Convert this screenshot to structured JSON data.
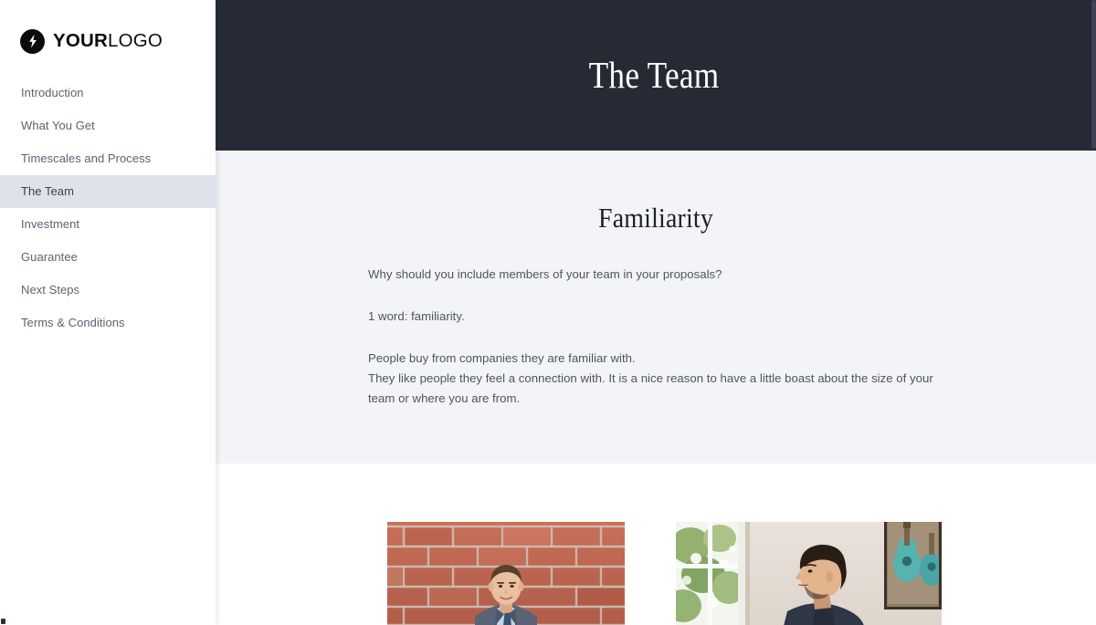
{
  "sidebar": {
    "logo": {
      "icon": "lightning-bolt-icon",
      "text_strong": "YOUR",
      "text_light": "LOGO"
    },
    "items": [
      {
        "label": "Introduction",
        "active": false
      },
      {
        "label": "What You Get",
        "active": false
      },
      {
        "label": "Timescales and Process",
        "active": false
      },
      {
        "label": "The Team",
        "active": true
      },
      {
        "label": "Investment",
        "active": false
      },
      {
        "label": "Guarantee",
        "active": false
      },
      {
        "label": "Next Steps",
        "active": false
      },
      {
        "label": "Terms & Conditions",
        "active": false
      }
    ]
  },
  "header": {
    "title": "The Team",
    "background_color": "#262a35",
    "text_color": "#ffffff"
  },
  "main": {
    "section": {
      "heading": "Familiarity",
      "background_color": "#f3f4f8",
      "paragraphs": [
        "Why should you include members of your team in your proposals?",
        "1 word: familiarity.",
        "People buy from companies they are familiar with.",
        "They like people they feel a connection with. It is a nice reason to have a little boast about the size of your team or where you are from."
      ]
    },
    "photos": [
      {
        "name": "team-member-photo-1",
        "alt": "Man in suit smiling in front of a red brick wall"
      },
      {
        "name": "team-member-photo-2",
        "alt": "Man in dark blazer in a bright office with window and guitar artwork"
      }
    ]
  },
  "colors": {
    "sidebar_background": "#ffffff",
    "sidebar_active": "#dfe2eb",
    "nav_text": "#5b6270",
    "body_text": "#4e545f",
    "heading_text": "#1d2027"
  }
}
